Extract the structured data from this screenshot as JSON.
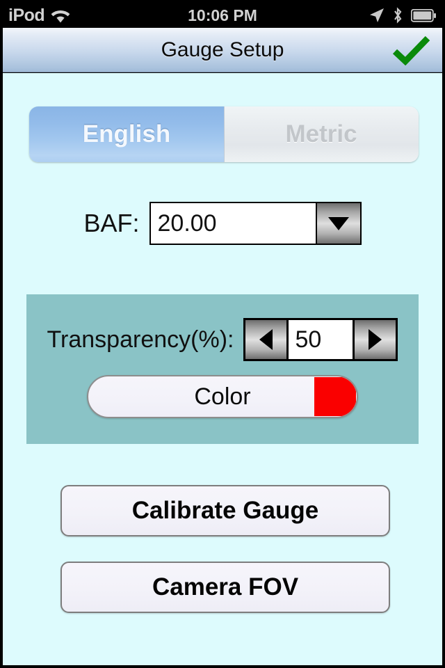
{
  "status_bar": {
    "carrier": "iPod",
    "wifi_icon": "wifi-icon",
    "time": "10:06 PM",
    "location_icon": "location-arrow-icon",
    "bluetooth_icon": "bluetooth-icon",
    "battery_icon": "battery-full-icon"
  },
  "nav_bar": {
    "title": "Gauge Setup",
    "done_icon": "check-icon",
    "done_color": "#0a8a0a"
  },
  "segmented_control": {
    "options": [
      {
        "label": "English",
        "selected": true
      },
      {
        "label": "Metric",
        "selected": false
      }
    ]
  },
  "baf": {
    "label": "BAF:",
    "value": "20.00",
    "dropdown_icon": "triangle-down-icon"
  },
  "transparency_panel": {
    "panel_color": "#8ac3c6",
    "label": "Transparency(%):",
    "value": "50",
    "decrement_icon": "triangle-left-icon",
    "increment_icon": "triangle-right-icon",
    "color_button": {
      "label": "Color",
      "swatch_color": "#fa0000"
    }
  },
  "actions": {
    "calibrate": "Calibrate Gauge",
    "camera_fov": "Camera FOV"
  },
  "theme": {
    "background": "#ddfbfd",
    "selected_segment": "#93bcea",
    "accent_green": "#0a8a0a"
  }
}
